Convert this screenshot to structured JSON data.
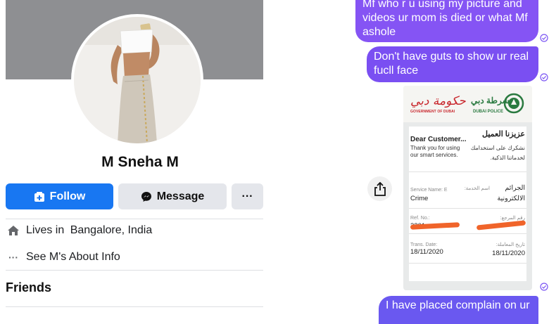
{
  "profile": {
    "name": "M Sneha M",
    "follow_label": "Follow",
    "message_label": "Message",
    "more_label": "···",
    "lives_prefix": "Lives in ",
    "lives_place": "Bangalore, India",
    "about_label": "See M's About Info",
    "about_icon_glyph": "···",
    "friends_heading": "Friends",
    "colors": {
      "accent": "#1877f2",
      "cover": "#8e8f92",
      "button_grey": "#e4e6eb"
    },
    "icons": [
      "user-plus-icon",
      "messenger-icon",
      "home-icon",
      "ellipsis-icon"
    ]
  },
  "chat": {
    "messages": [
      {
        "text": "Mf who r u using my picture  and videos ur mom is died or what Mf ashole",
        "status": "sent"
      },
      {
        "text": "Don't have guts to show ur real fucll face",
        "status": "sent"
      },
      {
        "text": "I have placed complain on ur",
        "status": "sent"
      }
    ],
    "bubble_color": "#7b55f3",
    "share_icon": "share-icon",
    "receipt": {
      "gov_logo_text": "حكومة دبي",
      "gov_subtitle": "GOVERNMENT OF DUBAI",
      "police_ar": "شرطة دبي",
      "police_en": "DUBAI POLICE",
      "greeting_ar": "عزيزنا العميل",
      "greeting_en": "Dear Customer...",
      "thanks_en_1": "Thank you for using",
      "thanks_en_2": "our smart services.",
      "thanks_ar_1": "نشكرك على استخدامك",
      "thanks_ar_2": "لخدماتنا الذكية.",
      "service_label_en": "Service Name: E",
      "service_value_en": "Crime",
      "service_label_ar": "اسم الخدمة:",
      "service_value_ar_1": "الجرائم",
      "service_value_ar_2": "الالكترونية",
      "ref_label_en": "Ref. No.:",
      "ref_label_ar": "رقم المرجع:",
      "ref_value_visible": "2201",
      "date_label_en": "Trans. Date:",
      "date_label_ar": "تاريخ المعاملة:",
      "date_value": "18/11/2020"
    }
  }
}
